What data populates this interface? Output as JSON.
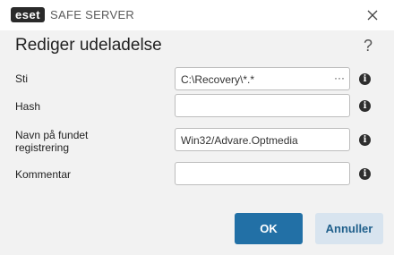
{
  "window": {
    "brand": "eset",
    "product": "SAFE SERVER",
    "close_glyph": "×"
  },
  "dialog": {
    "title": "Rediger udeladelse",
    "help_glyph": "?"
  },
  "fields": [
    {
      "label": "Sti",
      "value": "C:\\Recovery\\*.*",
      "has_browse": true,
      "browse_glyph": "···"
    },
    {
      "label": "Hash",
      "value": ""
    },
    {
      "label_line1": "Navn på fundet",
      "label_line2": "registrering",
      "value": "Win32/Advare.Optmedia"
    },
    {
      "label": "Kommentar",
      "value": ""
    }
  ],
  "info_glyph": "i",
  "buttons": {
    "ok": "OK",
    "cancel": "Annuller"
  },
  "colors": {
    "primary": "#2270a6",
    "secondary": "#d8e4ef",
    "background": "#f2f2f2"
  }
}
